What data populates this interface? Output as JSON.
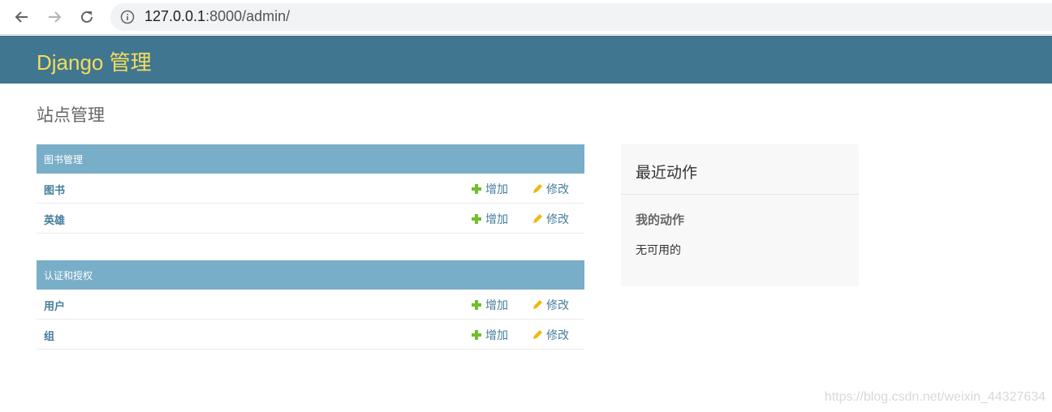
{
  "browser": {
    "url_host": "127.0.0.1",
    "url_rest": ":8000/admin/"
  },
  "header": {
    "branding": "Django 管理"
  },
  "page": {
    "title": "站点管理"
  },
  "apps": [
    {
      "caption": "图书管理",
      "models": [
        {
          "name": "图书",
          "add": "增加",
          "change": "修改"
        },
        {
          "name": "英雄",
          "add": "增加",
          "change": "修改"
        }
      ]
    },
    {
      "caption": "认证和授权",
      "models": [
        {
          "name": "用户",
          "add": "增加",
          "change": "修改"
        },
        {
          "name": "组",
          "add": "增加",
          "change": "修改"
        }
      ]
    }
  ],
  "recent_actions": {
    "title": "最近动作",
    "subtitle": "我的动作",
    "empty": "无可用的"
  },
  "watermark": "https://blog.csdn.net/weixin_44327634",
  "colors": {
    "header_bg": "#417690",
    "branding": "#f5dd5d",
    "caption_bg": "#79aec8",
    "link": "#447e9b",
    "add_icon": "#70bf2b",
    "change_icon": "#efb80b"
  }
}
